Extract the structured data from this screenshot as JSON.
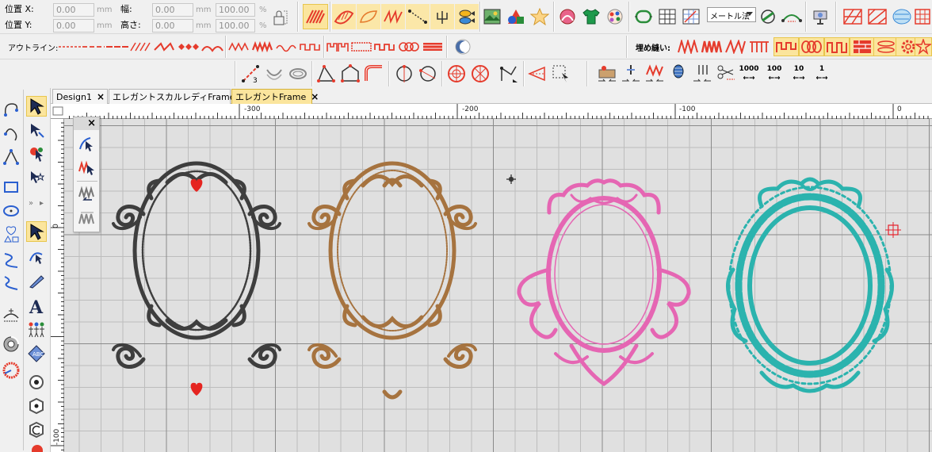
{
  "position": {
    "x_label": "位置 X:",
    "y_label": "位置 Y:",
    "x_value": "0.00",
    "y_value": "0.00",
    "unit_mm": "mm"
  },
  "size": {
    "width_label": "幅:",
    "height_label": "高さ:",
    "width_value": "0.00",
    "height_value": "0.00",
    "width_pct": "100.00",
    "height_pct": "100.00",
    "pct": "%"
  },
  "units_combo": "メートル法",
  "outline_label": "アウトライン:",
  "fill_label": "埋め縫い:",
  "density_labels": [
    "1000",
    "100",
    "10",
    "1"
  ],
  "tabs": [
    {
      "label": "Design1",
      "close": "×"
    },
    {
      "label": "エレガントスカルレディFrame",
      "close": "×"
    },
    {
      "label": "エレガントFrame",
      "close": "×",
      "active": true
    }
  ],
  "ruler": {
    "top_labels": [
      "-300",
      "-200",
      "-100",
      "0"
    ],
    "left_labels": [
      "0",
      "-100"
    ]
  },
  "float_close": "×",
  "frames": [
    {
      "name": "black",
      "color": "#3e3e3e",
      "accent": "#e52420"
    },
    {
      "name": "brown",
      "color": "#a6733f"
    },
    {
      "name": "pink",
      "color": "#e566b3"
    },
    {
      "name": "teal",
      "color": "#2bb3ae"
    }
  ],
  "accent_red": "#e5202a",
  "highlight_yellow": "#fbe59d"
}
